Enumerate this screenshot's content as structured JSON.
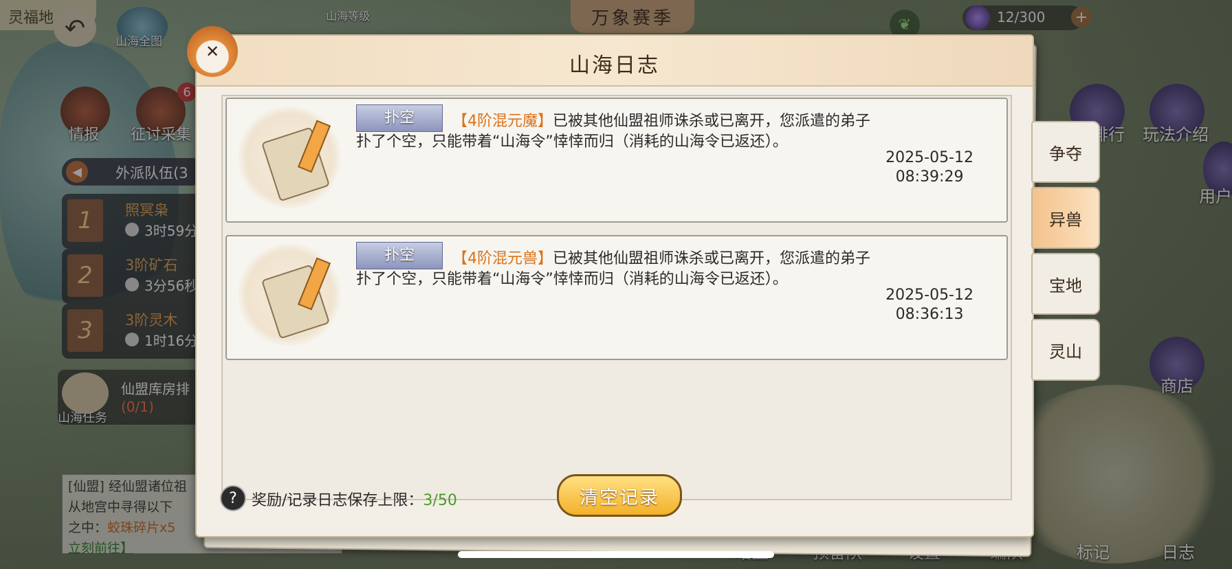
{
  "hud": {
    "top_left_fragment": "灵福地",
    "map_label": "山海全图",
    "level_label": "山海等级",
    "season_title": "万象赛季",
    "resource_value": "12/300",
    "side_intel": "情报",
    "side_gather": "征讨采集",
    "gather_badge": "6",
    "team_header": "外派队伍(3",
    "teams": [
      {
        "num": "1",
        "name": "照冥枭",
        "time": "3时59分"
      },
      {
        "num": "2",
        "name": "3阶矿石",
        "time": "3分56秒"
      },
      {
        "num": "3",
        "name": "3阶灵木",
        "time": "1时16分"
      }
    ],
    "quest_title": "仙盟库房排",
    "quest_progress": "(0/1)",
    "quest_label": "山海任务",
    "chat_line1": "[仙盟] 经仙盟诸位祖",
    "chat_line2": "从地宫中寻得以下",
    "chat_line3_prefix": "之中：",
    "chat_line3_item": "蛟珠碎片x5",
    "chat_link": "立刻前往】",
    "right_rank": "排行",
    "right_intro": "玩法介绍",
    "right_user": "用户",
    "right_shop": "商店",
    "bottom_labels": [
      "增益",
      "预备队",
      "设置",
      "编队",
      "标记",
      "日志"
    ]
  },
  "dialog": {
    "title": "山海日志",
    "entries": [
      {
        "tag": "扑空",
        "target": "【4阶混元魔】",
        "line1_rest": "已被其他仙盟祖师诛杀或已离开，您派遣的弟子",
        "line2": "扑了个空，只能带着“山海令”悻悻而归（消耗的山海令已返还）。",
        "date": "2025-05-12",
        "time": "08:39:29"
      },
      {
        "tag": "扑空",
        "target": "【4阶混元兽】",
        "line1_rest": "已被其他仙盟祖师诛杀或已离开，您派遣的弟子",
        "line2": "扑了个空，只能带着“山海令”悻悻而归（消耗的山海令已返还）。",
        "date": "2025-05-12",
        "time": "08:36:13"
      }
    ],
    "limit_label": "奖励/记录日志保存上限：",
    "limit_value": "3/50",
    "clear_button": "清空记录",
    "help_icon": "?"
  },
  "tabs": [
    {
      "label": "争夺",
      "active": false
    },
    {
      "label": "异兽",
      "active": true
    },
    {
      "label": "宝地",
      "active": false
    },
    {
      "label": "灵山",
      "active": false
    }
  ],
  "colors": {
    "highlight": "#d9731c",
    "limit_value": "#4b9a2a",
    "button_gold": "#f3b12a"
  }
}
